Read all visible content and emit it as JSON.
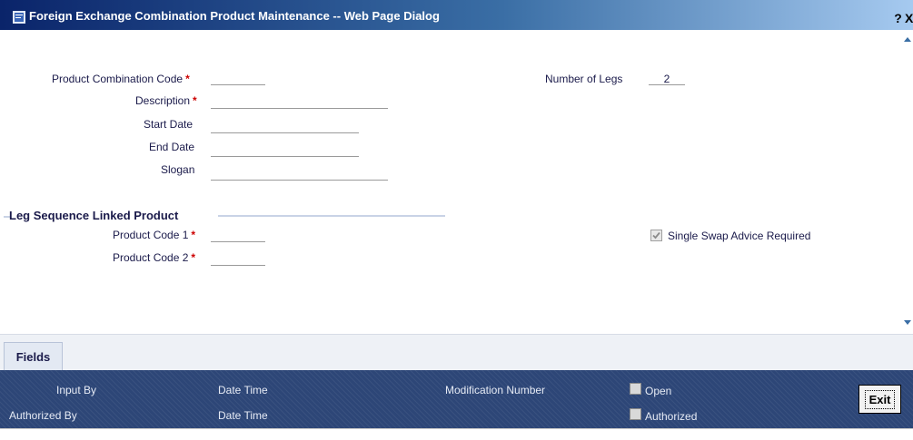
{
  "window": {
    "title": "Foreign Exchange Combination Product Maintenance -- Web Page Dialog",
    "help_label": "?",
    "close_label": "X"
  },
  "form": {
    "product_combination_code": {
      "label": "Product Combination Code",
      "required": "*",
      "value": ""
    },
    "description": {
      "label": "Description",
      "required": "*",
      "value": ""
    },
    "start_date": {
      "label": "Start Date",
      "value": ""
    },
    "end_date": {
      "label": "End Date",
      "value": ""
    },
    "slogan": {
      "label": "Slogan",
      "value": ""
    },
    "number_of_legs": {
      "label": "Number of Legs",
      "value": "2"
    }
  },
  "leg_section": {
    "title": "Leg Sequence Linked Product",
    "product_code_1": {
      "label": "Product Code 1",
      "required": "*",
      "value": ""
    },
    "product_code_2": {
      "label": "Product Code 2",
      "required": "*",
      "value": ""
    },
    "single_swap_advice": {
      "label": "Single Swap Advice Required",
      "checked": true
    }
  },
  "tabs": [
    {
      "label": "Fields"
    }
  ],
  "footer": {
    "input_by": "Input By",
    "authorized_by": "Authorized By",
    "date_time_1": "Date Time",
    "date_time_2": "Date Time",
    "modification_number": "Modification Number",
    "open": "Open",
    "authorized": "Authorized",
    "exit_label": "Exit"
  },
  "colors": {
    "title_gradient_start": "#0a246a",
    "footer_bg": "#2d4677",
    "required": "#cc0000",
    "label_text": "#1a1a4a"
  }
}
